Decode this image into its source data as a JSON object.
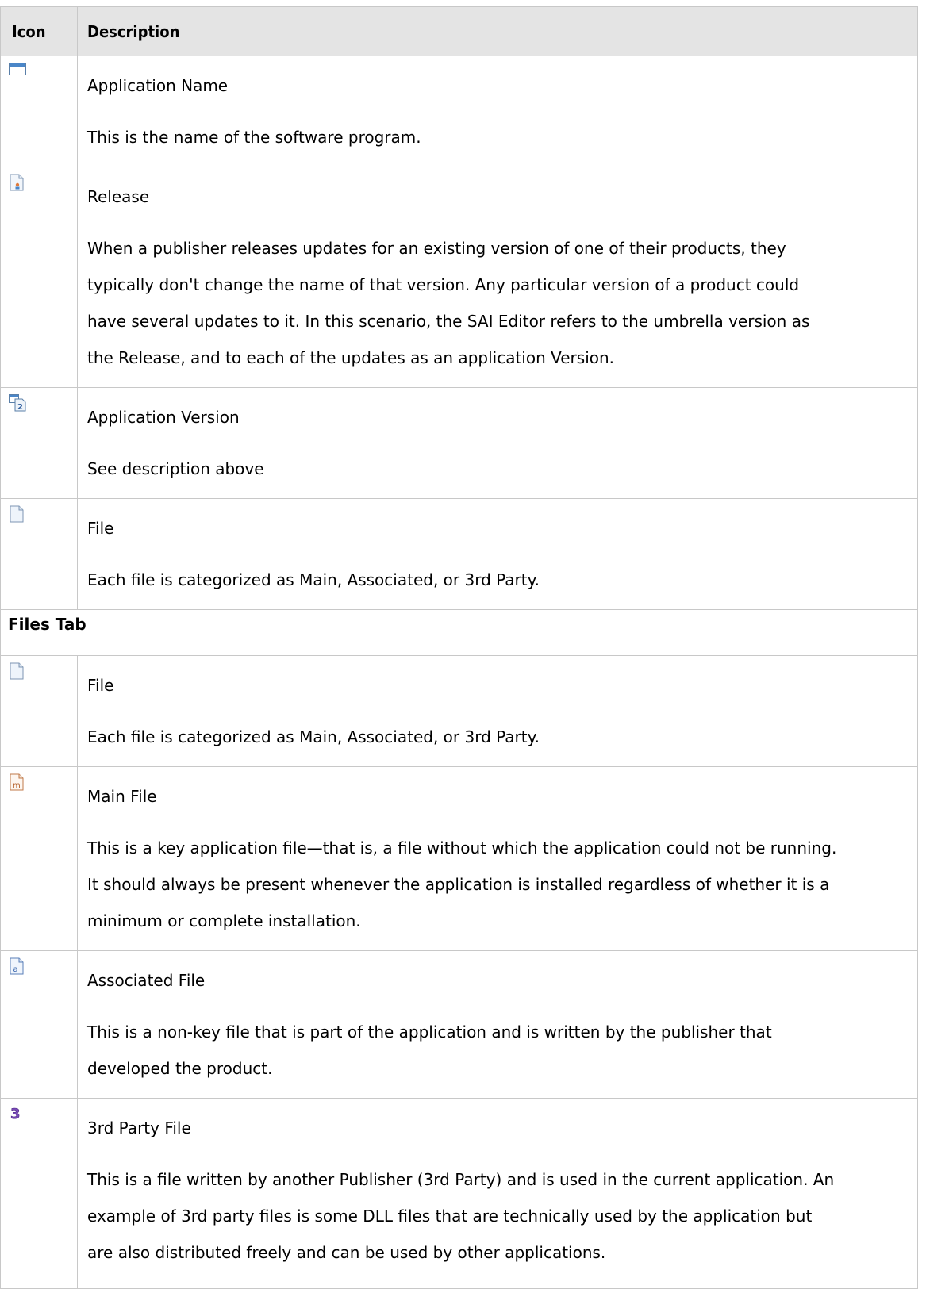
{
  "header": {
    "col_icon": "Icon",
    "col_description": "Description"
  },
  "rows": [
    {
      "icon": "application-window-icon",
      "title": "Application Name",
      "lines": [
        "This is the name of the software program."
      ]
    },
    {
      "icon": "release-icon",
      "title": "Release",
      "lines": [
        "When a publisher releases updates for an existing version of one of their products, they",
        "typically don't change the name of that version. Any particular version of a product could",
        "have several updates to it. In this scenario, the SAI Editor refers to the umbrella version as",
        "the Release, and to each of the updates as an application Version."
      ]
    },
    {
      "icon": "application-version-icon",
      "title": "Application Version",
      "lines": [
        "See description above"
      ]
    },
    {
      "icon": "file-icon",
      "title": "File",
      "lines": [
        "Each file is categorized as Main, Associated, or 3rd Party."
      ]
    }
  ],
  "section_label": "Files Tab",
  "files_rows": [
    {
      "icon": "file-icon",
      "title": "File",
      "lines": [
        "Each file is categorized as Main, Associated, or 3rd Party."
      ]
    },
    {
      "icon": "main-file-icon",
      "title": "Main File",
      "lines": [
        "This is a key application file—that is, a file without which the application could not be running.",
        "It should always be present whenever the application is installed regardless of whether it is a",
        "minimum or complete installation."
      ]
    },
    {
      "icon": "associated-file-icon",
      "title": "Associated File",
      "lines": [
        "This is a non-key file that is part of the application and is written by the publisher that",
        "developed the product."
      ]
    },
    {
      "icon": "third-party-file-icon",
      "title": "3rd Party File",
      "lines": [
        "This is a file written by another Publisher (3rd Party) and is used in the current application. An",
        "example of 3rd party files is some DLL files that are technically used by the application but",
        "are also distributed freely and can be used by other applications."
      ]
    }
  ],
  "colors": {
    "header_bg": "#e4e4e4",
    "border": "#c8c8c8"
  }
}
